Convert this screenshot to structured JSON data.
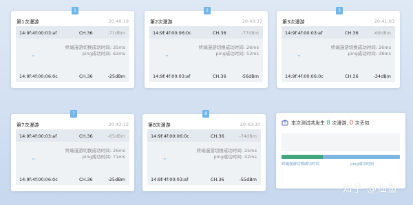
{
  "cards": [
    {
      "badge": "1",
      "title": "第1次漫游",
      "time": "20:40:19",
      "from": {
        "mac": "14:9f:4f:00:03:af",
        "ch": "CH.36",
        "signal": "-71dBm"
      },
      "switch_label": "终端漫游切换成功时间:",
      "switch_value": "35ms",
      "ping_label": "ping成功时间:",
      "ping_value": "62ms",
      "to": {
        "mac": "14:9f:4f:00:06:0c",
        "ch": "CH.36",
        "signal": "-25dBm"
      }
    },
    {
      "badge": "2",
      "title": "第2次漫游",
      "time": "20:40:37",
      "from": {
        "mac": "14:9f:4f:00:06:0c",
        "ch": "CH.36",
        "signal": "-77dBm"
      },
      "switch_label": "终端漫游切换成功时间:",
      "switch_value": "26ms",
      "ping_label": "ping成功时间:",
      "ping_value": "53ms",
      "to": {
        "mac": "14:9f:4f:00:03:af",
        "ch": "CH.36",
        "signal": "-56dBm"
      }
    },
    {
      "badge": "3",
      "title": "第3次漫游",
      "time": "20:41:03",
      "from": {
        "mac": "14:9f:4f:00:03:af",
        "ch": "CH.36",
        "signal": "-68dBm"
      },
      "switch_label": "终端漫游切换成功时间:",
      "switch_value": "26ms",
      "ping_label": "ping成功时间:",
      "ping_value": "38ms",
      "to": {
        "mac": "14:9f:4f:00:06:0c",
        "ch": "CH.36",
        "signal": "-34dBm"
      }
    },
    {
      "badge": "7",
      "title": "第7次漫游",
      "time": "20:43:12",
      "from": {
        "mac": "14:9f:4f:00:03:af",
        "ch": "CH.36",
        "signal": "-65dBm"
      },
      "switch_label": "终端漫游切换成功时间:",
      "switch_value": "26ms",
      "ping_label": "ping成功时间:",
      "ping_value": "71ms",
      "to": {
        "mac": "14:9f:4f:00:06:0c",
        "ch": "CH.36",
        "signal": "-25dBm"
      }
    },
    {
      "badge": "8",
      "title": "第8次漫游",
      "time": "20:43:30",
      "from": {
        "mac": "14:9f:4f:00:06:0c",
        "ch": "CH.36",
        "signal": "-74dBm"
      },
      "switch_label": "终端漫游切换成功时间:",
      "switch_value": "25ms",
      "ping_label": "ping成功时间:",
      "ping_value": "42ms",
      "to": {
        "mac": "14:9f:4f:00:03:af",
        "ch": "CH.36",
        "signal": "-55dBm"
      }
    }
  ],
  "summary": {
    "prefix": "本次测试共发生",
    "roam_count": "8",
    "roam_unit": "次漫游,",
    "loss_count": "0",
    "loss_unit": "次丢包",
    "bar_green_fraction": 0.35,
    "legend_switch": "终端漫游切换成功时间",
    "legend_ping": "ping成功时间",
    "icon": "bag-icon"
  },
  "watermark": "知乎 @仙鱼",
  "colors": {
    "accent": "#6fb6ea",
    "green": "#3aa57a",
    "red": "#d9534f"
  }
}
